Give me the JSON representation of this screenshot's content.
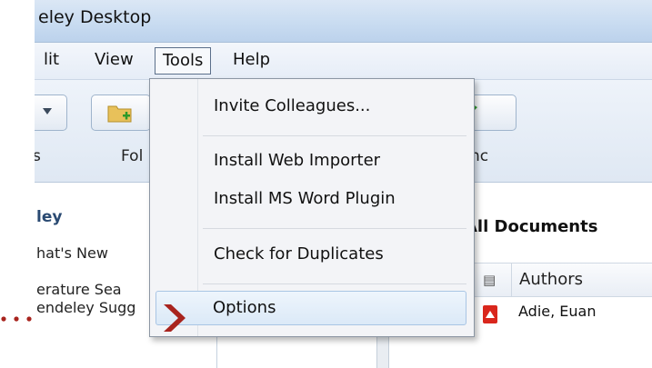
{
  "app": {
    "title": "eley Desktop"
  },
  "menubar": {
    "items": [
      "lit",
      "View",
      "Tools",
      "Help"
    ]
  },
  "toolbar": {
    "labels": [
      "s",
      "Fol",
      "nc"
    ]
  },
  "sidebar": {
    "header": "ley",
    "items": [
      "hat's New",
      "erature Sea",
      "endeley Sugg"
    ]
  },
  "main": {
    "title": "All Documents",
    "columns": {
      "authors": "Authors"
    },
    "rows": [
      {
        "author": "Adie, Euan"
      }
    ]
  },
  "tools_menu": {
    "items": [
      {
        "label": "Invite Colleagues..."
      },
      {
        "label": "Install Web Importer"
      },
      {
        "label": "Install MS Word Plugin"
      },
      {
        "label": "Check for Duplicates"
      },
      {
        "label": "Options"
      }
    ]
  },
  "colors": {
    "annotation_arrow": "#a8241e",
    "menu_hover": "#dbe9f7"
  }
}
